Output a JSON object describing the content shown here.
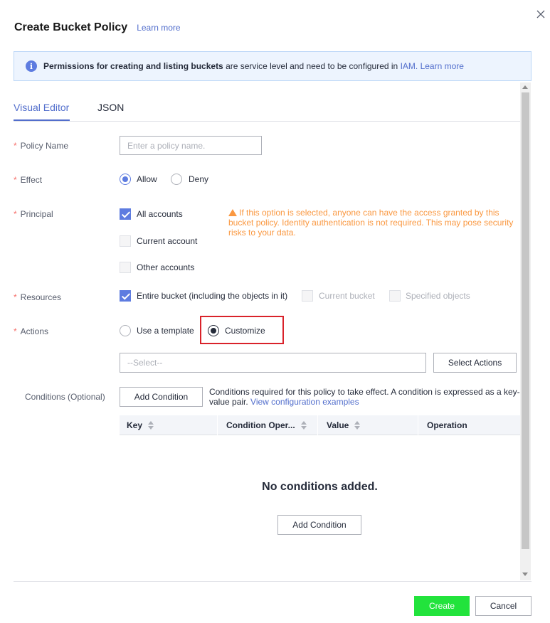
{
  "dialog": {
    "title": "Create Bucket Policy",
    "title_link": "Learn more"
  },
  "banner": {
    "icon": "info-icon",
    "strong": "Permissions for creating and listing buckets",
    "text": " are service level and need to be configured in ",
    "iam_link": "IAM.",
    "learn_link": "Learn more"
  },
  "tabs": {
    "visual": "Visual Editor",
    "json": "JSON",
    "active": "Visual Editor"
  },
  "form": {
    "policy_name": {
      "label": "Policy Name",
      "placeholder": "Enter a policy name."
    },
    "effect": {
      "label": "Effect",
      "allow": "Allow",
      "deny": "Deny",
      "selected": "Allow"
    },
    "principal": {
      "label": "Principal",
      "all_accounts": "All accounts",
      "current_account": "Current account",
      "other_accounts": "Other accounts",
      "warning": "If this option is selected, anyone can have the access granted by this bucket policy. Identity authentication is not required. This may pose security risks to your data."
    },
    "resources": {
      "label": "Resources",
      "entire_bucket": "Entire bucket (including the objects in it)",
      "current_bucket": "Current bucket",
      "specified_objects": "Specified objects"
    },
    "actions": {
      "label": "Actions",
      "use_template": "Use a template",
      "customize": "Customize",
      "selected": "Customize",
      "select_placeholder": "--Select--",
      "select_actions_button": "Select Actions"
    },
    "conditions": {
      "label": "Conditions (Optional)",
      "add_button": "Add Condition",
      "description": "Conditions required for this policy to take effect. A condition is expressed as a key-value pair. ",
      "examples_link": "View configuration examples",
      "columns": [
        "Key",
        "Condition Oper...",
        "Value",
        "Operation"
      ],
      "empty": "No conditions added.",
      "empty_add_button": "Add Condition"
    }
  },
  "footer": {
    "create": "Create",
    "cancel": "Cancel"
  },
  "colors": {
    "primary": "#5e7ce0",
    "link": "#526ecc",
    "warning": "#fa9841",
    "create": "#22e33c",
    "highlight": "#d9222a"
  }
}
